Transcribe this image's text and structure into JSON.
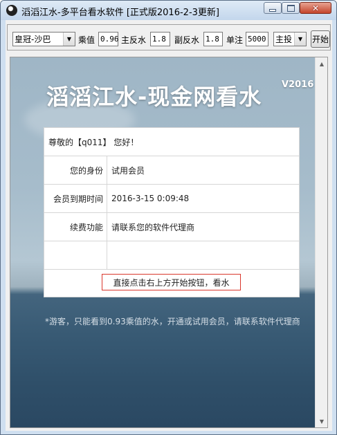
{
  "window": {
    "title": "滔滔江水-多平台看水软件  [正式版2016-2-3更新]",
    "close_glyph": "✕"
  },
  "toolbar": {
    "platform_select": "皇冠-沙巴",
    "multiplier_label": "乘值",
    "multiplier_value": "0.96",
    "main_rebate_label": "主反水",
    "main_rebate_value": "1.8",
    "sub_rebate_label": "副反水",
    "sub_rebate_value": "1.8",
    "single_bet_label": "单注",
    "single_bet_value": "5000",
    "bet_mode_select": "主投",
    "start_label": "开始"
  },
  "content": {
    "heading": "滔滔江水-现金网看水",
    "version": "V2016",
    "greeting": "尊敬的【q011】 您好！",
    "rows": [
      {
        "label": "您的身份",
        "value": "试用会员"
      },
      {
        "label": "会员到期时间",
        "value": "2016-3-15 0:09:48"
      },
      {
        "label": "续费功能",
        "value": "请联系您的软件代理商"
      },
      {
        "label": "",
        "value": ""
      }
    ],
    "action_text": "直接点击右上方开始按钮，看水",
    "note": "*游客，只能看到0.93乘值的水，开通或试用会员，请联系软件代理商"
  },
  "colors": {
    "accent_border": "#d9362b",
    "heading_text": "#ffffff"
  }
}
